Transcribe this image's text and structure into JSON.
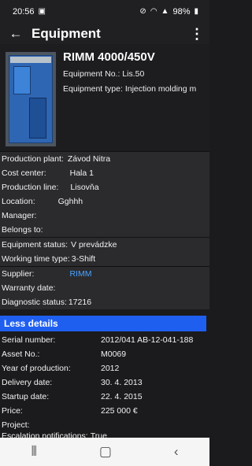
{
  "status_bar": {
    "time": "20:56",
    "battery": "98%",
    "icons": [
      "gallery-icon",
      "mute-icon",
      "wifi-icon",
      "signal-icon",
      "battery-icon"
    ]
  },
  "app_bar": {
    "title": "Equipment",
    "back_icon": "arrow-back-icon",
    "menu_icon": "more-vert-icon"
  },
  "equipment": {
    "name": "RIMM 4000/450V",
    "number_label": "Equipment No.:",
    "number_value": "Lis.50",
    "type_label": "Equipment type:",
    "type_value": "Injection molding m"
  },
  "details": {
    "production_plant_label": "Production plant:",
    "production_plant_value": "Závod Nitra",
    "cost_center_label": "Cost center:",
    "cost_center_value": "Hala 1",
    "production_line_label": "Production line:",
    "production_line_value": "Lisovňa",
    "location_label": "Location:",
    "location_value": "Gghhh",
    "manager_label": "Manager:",
    "belongs_to_label": "Belongs to:",
    "equipment_status_label": "Equipment status:",
    "equipment_status_value": "V prevádzke",
    "working_time_type_label": "Working time type:",
    "working_time_type_value": "3-Shift",
    "supplier_label": "Supplier:",
    "supplier_value": "RIMM",
    "warranty_label": "Warranty date:",
    "diagnostic_label": "Diagnostic status:",
    "diagnostic_value": "17216"
  },
  "less_details": {
    "label": "Less details",
    "serial_label": "Serial number:",
    "serial_value": "2012/041 AB-12-041-188",
    "asset_label": "Asset No.:",
    "asset_value": "M0069",
    "year_label": "Year of production:",
    "year_value": "2012",
    "delivery_label": "Delivery date:",
    "delivery_value": "30. 4. 2013",
    "startup_label": "Startup date:",
    "startup_value": "22. 4. 2015",
    "price_label": "Price:",
    "price_value": "225 000 €",
    "project_label": "Project:",
    "escalation_label": "Escalation notifications:",
    "escalation_value": "True"
  },
  "nav": {
    "recents_icon": "recents-icon",
    "home_icon": "home-icon",
    "back_icon": "nav-back-icon"
  }
}
